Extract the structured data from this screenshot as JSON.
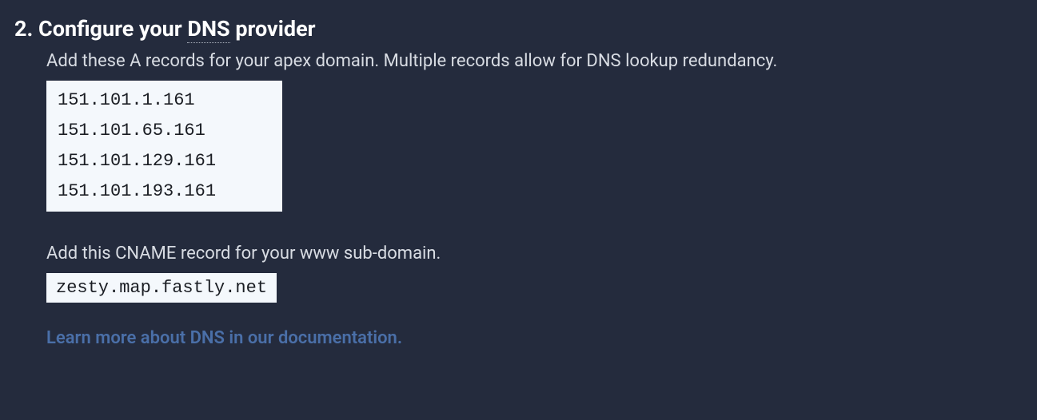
{
  "step": {
    "number": "2.",
    "title_prefix": "Configure your ",
    "title_abbr": "DNS",
    "title_suffix": " provider"
  },
  "a_records": {
    "description": "Add these A records for your apex domain. Multiple records allow for DNS lookup redundancy.",
    "records": [
      "151.101.1.161",
      "151.101.65.161",
      "151.101.129.161",
      "151.101.193.161"
    ]
  },
  "cname": {
    "description": "Add this CNAME record for your www sub-domain.",
    "value": "zesty.map.fastly.net"
  },
  "learn_more": "Learn more about DNS in our documentation."
}
